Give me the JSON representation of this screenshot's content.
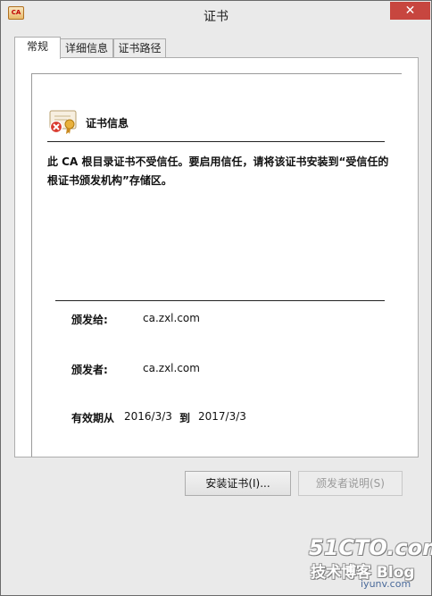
{
  "window": {
    "title": "证书",
    "app_icon_text": "CA",
    "close_glyph": "✕"
  },
  "tabs": [
    {
      "label": "常规",
      "active": true
    },
    {
      "label": "详细信息",
      "active": false
    },
    {
      "label": "证书路径",
      "active": false
    }
  ],
  "general": {
    "section_title": "证书信息",
    "warning_text": "此 CA 根目录证书不受信任。要启用信任，请将该证书安装到“受信任的根证书颁发机构”存储区。",
    "issued_to_label": "颁发给:",
    "issued_to_value": "ca.zxl.com",
    "issued_by_label": "颁发者:",
    "issued_by_value": "ca.zxl.com",
    "validity_label": "有效期从",
    "valid_from": "2016/3/3",
    "validity_to_word": "到",
    "valid_to": "2017/3/3"
  },
  "buttons": {
    "install_label": "安装证书(I)...",
    "issuer_statement_label": "颁发者说明(S)"
  },
  "watermark": {
    "line1": "51CTO.com",
    "line2": "技术博客",
    "line3": "Blog",
    "url": "iyunv.com"
  },
  "colors": {
    "close_button": "#c7463f",
    "window_bg": "#eaeaea",
    "cert_error_red": "#d93a2e"
  },
  "icons": {
    "app": "certificate-icon",
    "close": "close-icon",
    "cert_info": "certificate-error-icon"
  }
}
